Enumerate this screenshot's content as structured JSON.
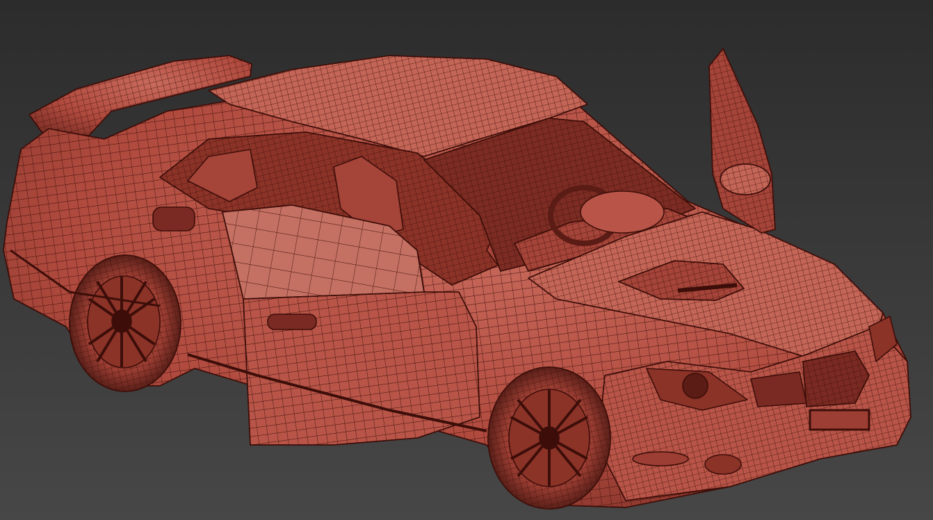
{
  "viewport": {
    "background_top": "#2c2c2c",
    "background_bottom": "#474747",
    "shading_mode_icon": "wireframe-on-shaded-icon"
  },
  "model": {
    "fill_color": "#b04a3e",
    "fill_light": "#c86a5c",
    "fill_dark": "#6e2a22",
    "wire_color": "#3d0e09",
    "parts": [
      "body-shell",
      "roof",
      "rear-spoiler",
      "hood",
      "hood-scoop",
      "front-bumper",
      "front-grille",
      "left-headlight",
      "right-headlight",
      "fog-light",
      "front-wheel",
      "rear-wheel",
      "front-door-open",
      "rear-door-open",
      "right-door-open-vertical",
      "side-mirror",
      "windshield-frame",
      "steering-wheel",
      "front-seat",
      "rear-seat",
      "roll-cage"
    ]
  }
}
